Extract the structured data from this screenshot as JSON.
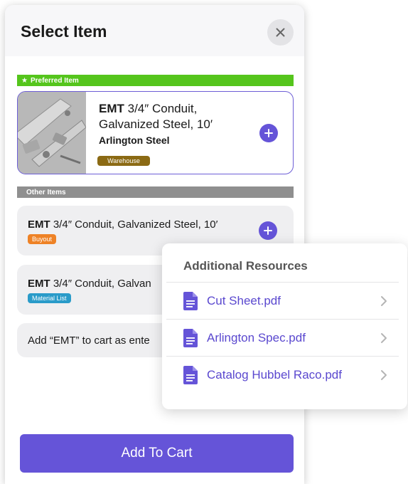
{
  "modal": {
    "title": "Select Item"
  },
  "preferred": {
    "section_label": "Preferred Item",
    "brand": "EMT",
    "description": " 3/4″ Conduit, Galvanized Steel, 10′",
    "vendor": "Arlington Steel",
    "badge": "Warehouse"
  },
  "other": {
    "section_label": "Other Items",
    "items": [
      {
        "brand": "EMT",
        "description": " 3/4″ Conduit, Galvanized Steel, 10′",
        "badge": "Buyout"
      },
      {
        "brand": "EMT",
        "description": " 3/4″ Conduit, Galvan",
        "badge": "Material List"
      }
    ],
    "add_to_cart_text": "Add “EMT” to cart as ente"
  },
  "footer": {
    "add_to_cart_label": "Add To Cart"
  },
  "popover": {
    "title": "Additional Resources",
    "resources": [
      {
        "label": "Cut Sheet.pdf"
      },
      {
        "label": "Arlington Spec.pdf"
      },
      {
        "label": "Catalog Hubbel Raco.pdf"
      }
    ]
  },
  "colors": {
    "accent": "#6554d8",
    "preferred_green": "#55c51c",
    "other_gray": "#8f8f8f",
    "warehouse_badge": "#8b6a14",
    "buyout_badge": "#ee8226",
    "material_list_badge": "#2a9bc9"
  },
  "icons": {
    "close": "close-icon",
    "star": "star-icon",
    "add": "plus-circle-icon",
    "document": "document-icon",
    "chevron": "chevron-right-icon"
  }
}
